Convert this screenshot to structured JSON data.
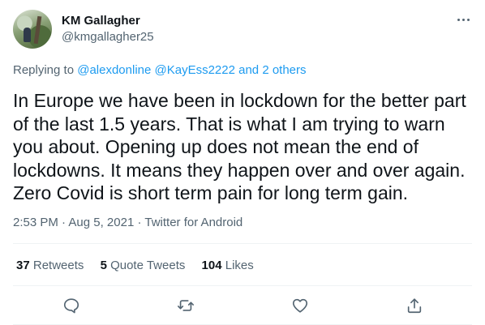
{
  "author": {
    "name": "KM Gallagher",
    "handle": "@kmgallagher25"
  },
  "reply": {
    "prefix": "Replying to",
    "mentions": "@alexdonline @KayEss2222 and 2 others"
  },
  "tweet": {
    "lines": [
      "In Europe we have been in lockdown for the better part",
      "of the last 1.5 years. That is what I am trying to warn",
      "you about. Opening up does not mean the end of",
      "lockdowns. It means they happen over and over again.",
      "Zero Covid is short term pain for long term gain."
    ]
  },
  "meta": {
    "time": "2:53 PM",
    "sep1": "·",
    "date": "Aug 5, 2021",
    "sep2": "·",
    "source": "Twitter for Android"
  },
  "stats": {
    "retweets_count": "37",
    "retweets_label": "Retweets",
    "quotes_count": "5",
    "quotes_label": "Quote Tweets",
    "likes_count": "104",
    "likes_label": "Likes"
  },
  "actions": [
    "comment-icon",
    "retweet-icon",
    "like-icon",
    "share-icon"
  ],
  "colors": {
    "text": "#0f1419",
    "secondary": "#536471",
    "link": "#1d9bf0",
    "divider": "#eff3f4"
  }
}
